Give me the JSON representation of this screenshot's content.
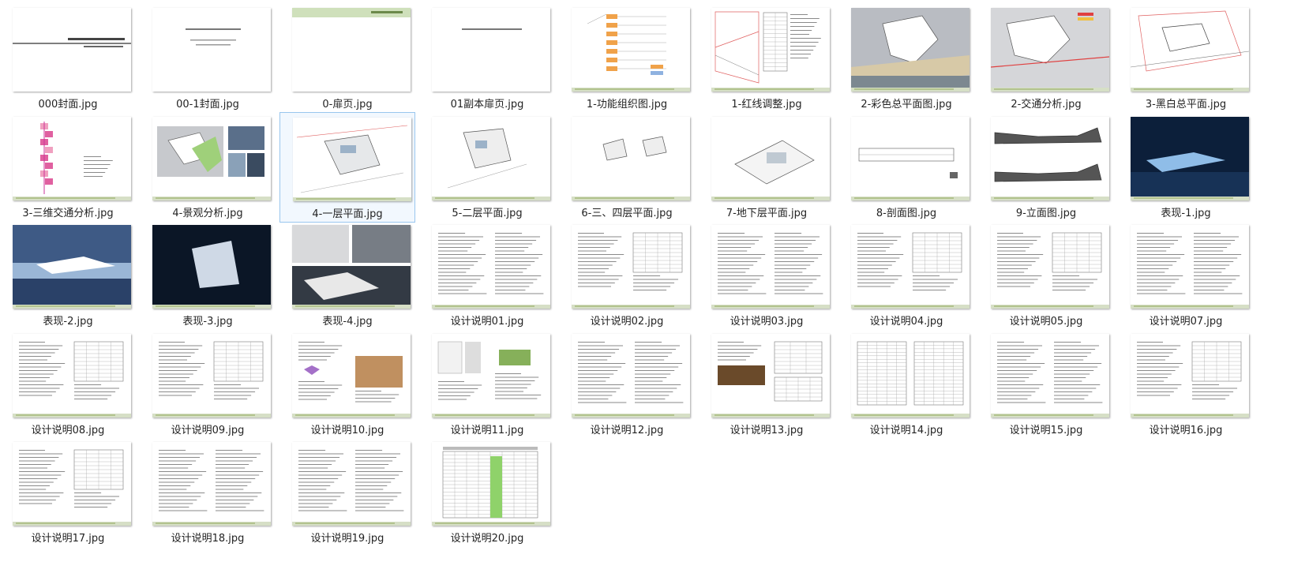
{
  "files": [
    {
      "name": "000封面.jpg",
      "kind": "cover"
    },
    {
      "name": "00-1封面.jpg",
      "kind": "cover2"
    },
    {
      "name": "0-扉页.jpg",
      "kind": "flyleaf"
    },
    {
      "name": "01副本扉页.jpg",
      "kind": "flyleaf2"
    },
    {
      "name": "1-功能组织图.jpg",
      "kind": "org"
    },
    {
      "name": "1-红线调整.jpg",
      "kind": "redline"
    },
    {
      "name": "2-彩色总平面图.jpg",
      "kind": "colorplan"
    },
    {
      "name": "2-交通分析.jpg",
      "kind": "traffic"
    },
    {
      "name": "3-黑白总平面.jpg",
      "kind": "bwplan"
    },
    {
      "name": "3-三维交通分析.jpg",
      "kind": "traffic3d"
    },
    {
      "name": "4-景观分析.jpg",
      "kind": "landscape"
    },
    {
      "name": "4-一层平面.jpg",
      "kind": "plan",
      "selected": true
    },
    {
      "name": "5-二层平面.jpg",
      "kind": "plan2"
    },
    {
      "name": "6-三、四层平面.jpg",
      "kind": "plan34"
    },
    {
      "name": "7-地下层平面.jpg",
      "kind": "basement"
    },
    {
      "name": "8-剖面图.jpg",
      "kind": "section"
    },
    {
      "name": "9-立面图.jpg",
      "kind": "elevation"
    },
    {
      "name": "表现-1.jpg",
      "kind": "render-night"
    },
    {
      "name": "表现-2.jpg",
      "kind": "render-dusk"
    },
    {
      "name": "表现-3.jpg",
      "kind": "render-dark"
    },
    {
      "name": "表现-4.jpg",
      "kind": "render-collage"
    },
    {
      "name": "设计说明01.jpg",
      "kind": "text"
    },
    {
      "name": "设计说明02.jpg",
      "kind": "text-table"
    },
    {
      "name": "设计说明03.jpg",
      "kind": "text"
    },
    {
      "name": "设计说明04.jpg",
      "kind": "text-table"
    },
    {
      "name": "设计说明05.jpg",
      "kind": "text-table"
    },
    {
      "name": "设计说明07.jpg",
      "kind": "text"
    },
    {
      "name": "设计说明08.jpg",
      "kind": "text-table"
    },
    {
      "name": "设计说明09.jpg",
      "kind": "text-table"
    },
    {
      "name": "设计说明10.jpg",
      "kind": "text-img"
    },
    {
      "name": "设计说明11.jpg",
      "kind": "text-diagram"
    },
    {
      "name": "设计说明12.jpg",
      "kind": "text"
    },
    {
      "name": "设计说明13.jpg",
      "kind": "text-photo"
    },
    {
      "name": "设计说明14.jpg",
      "kind": "table"
    },
    {
      "name": "设计说明15.jpg",
      "kind": "text"
    },
    {
      "name": "设计说明16.jpg",
      "kind": "text-table"
    },
    {
      "name": "设计说明17.jpg",
      "kind": "text-table"
    },
    {
      "name": "设计说明18.jpg",
      "kind": "text"
    },
    {
      "name": "设计说明19.jpg",
      "kind": "text"
    },
    {
      "name": "设计说明20.jpg",
      "kind": "green-table"
    }
  ],
  "colors": {
    "selection_border": "#99c6ee",
    "selection_fill": "#f2f8fe",
    "footer_green": "#b2c38e",
    "label_text": "#222222"
  }
}
